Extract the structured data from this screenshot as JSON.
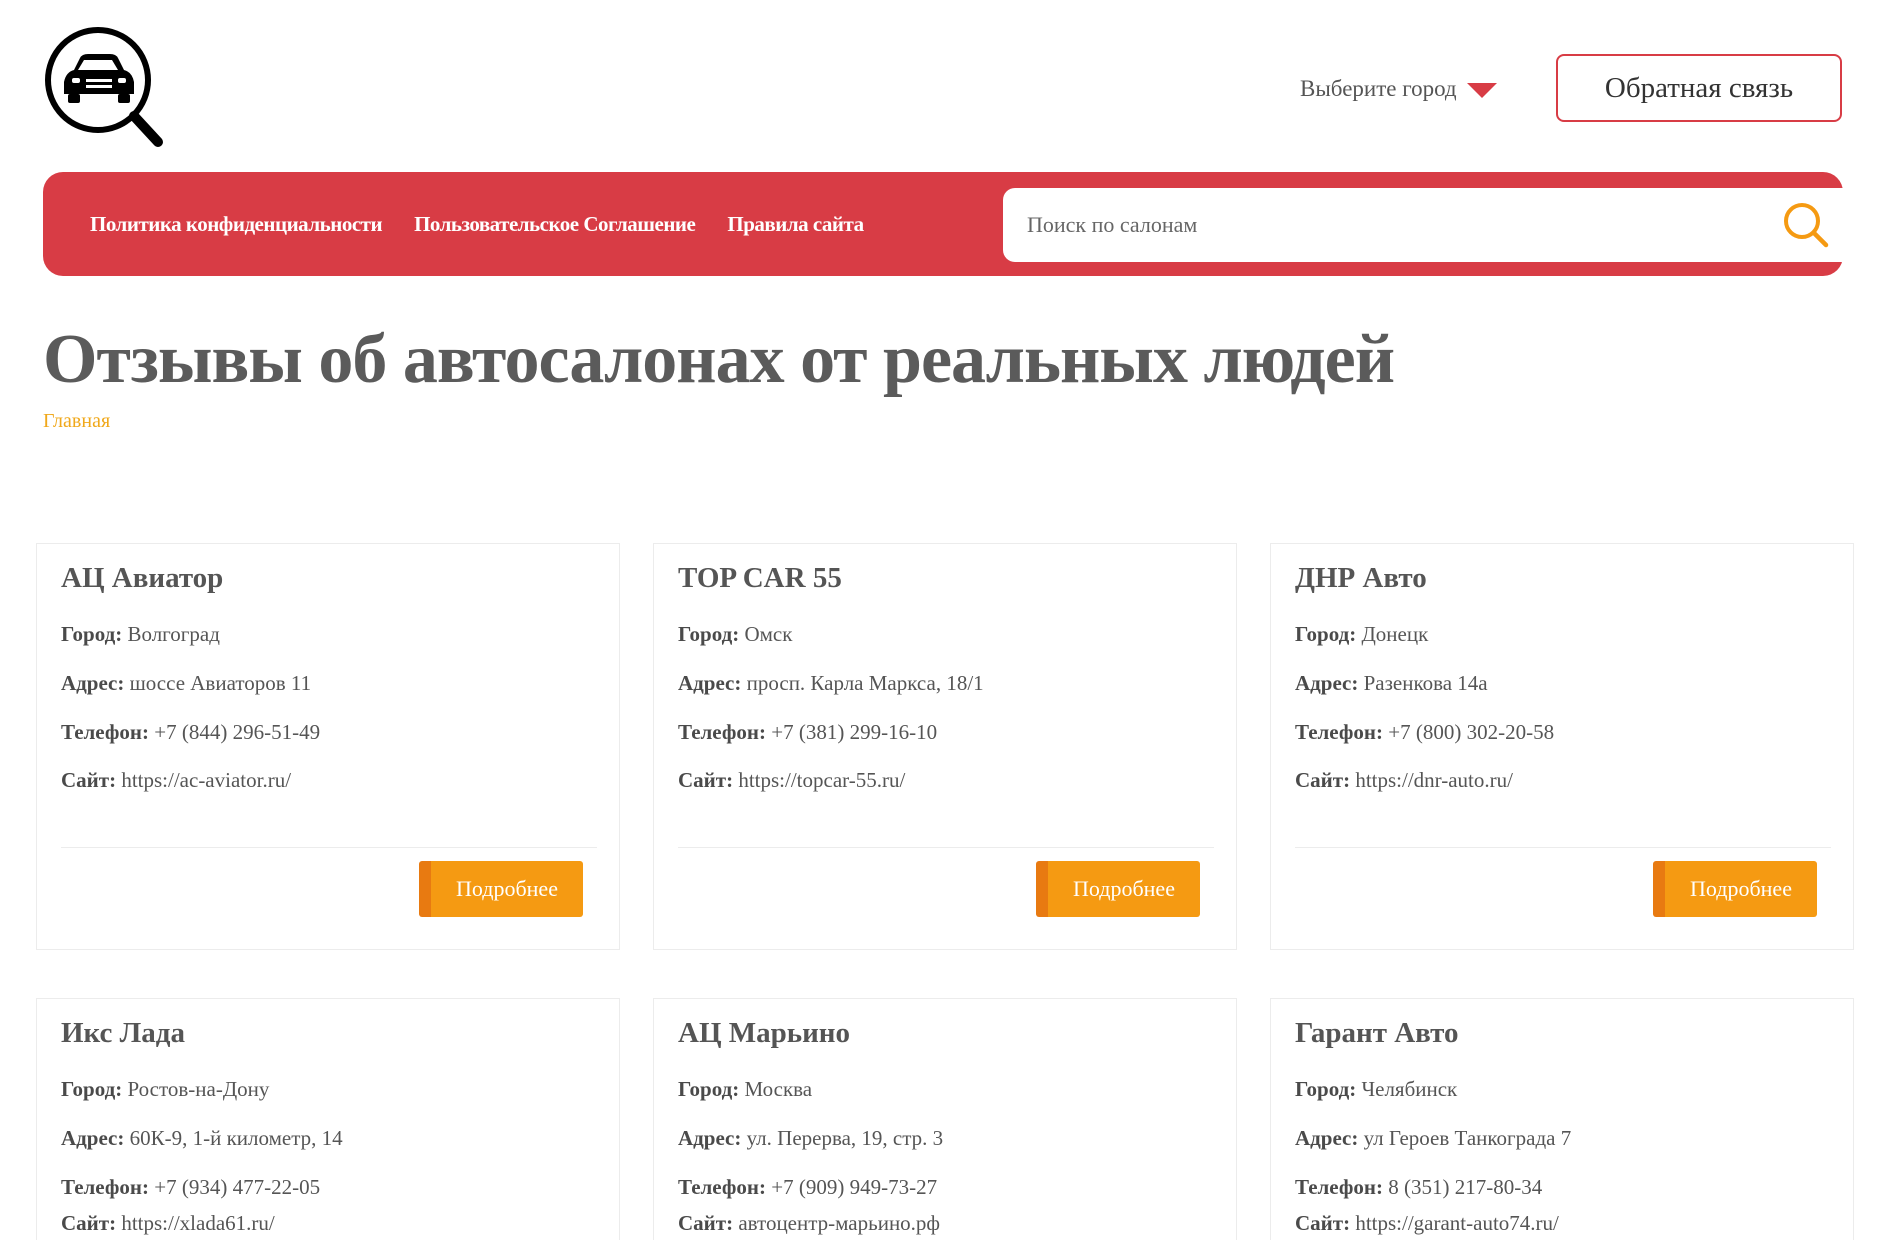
{
  "header": {
    "city_select_label": "Выберите город",
    "feedback_button": "Обратная связь"
  },
  "nav": {
    "links": [
      "Политика конфиденциальности",
      "Пользовательское Соглашение",
      "Правила сайта"
    ],
    "search_placeholder": "Поиск по салонам"
  },
  "page": {
    "title": "Отзывы об автосалонах от реальных людей",
    "breadcrumb": "Главная"
  },
  "field_labels": {
    "city": "Город:",
    "address": "Адрес:",
    "phone": "Телефон:",
    "site": "Сайт:"
  },
  "more_button": "Подробнее",
  "dealers": [
    {
      "name": "АЦ Авиатор",
      "city": "Волгоград",
      "address": "шоссе Авиаторов 11",
      "phone": "+7 (844) 296-51-49",
      "site": "https://ac-aviator.ru/"
    },
    {
      "name": "TOP CAR 55",
      "city": "Омск",
      "address": "просп. Карла Маркса, 18/1",
      "phone": "+7 (381) 299-16-10",
      "site": "https://topcar-55.ru/"
    },
    {
      "name": "ДНР Авто",
      "city": "Донецк",
      "address": "Разенкова 14а",
      "phone": "+7 (800) 302-20-58",
      "site": "https://dnr-auto.ru/"
    },
    {
      "name": "Икс Лада",
      "city": "Ростов-на-Дону",
      "address": "60К-9, 1-й километр, 14",
      "phone": "+7 (934) 477-22-05",
      "site": "https://xlada61.ru/"
    },
    {
      "name": "АЦ Марьино",
      "city": "Москва",
      "address": "ул. Перерва, 19, стр. 3",
      "phone": "+7 (909) 949-73-27",
      "site": "автоцентр-марьино.рф"
    },
    {
      "name": "Гарант Авто",
      "city": "Челябинск",
      "address": "ул Героев Танкограда 7",
      "phone": "8 (351) 217-80-34",
      "site": "https://garant-auto74.ru/"
    }
  ],
  "colors": {
    "accent_red": "#d83c45",
    "button_orange": "#f59a12",
    "breadcrumb_orange": "#f0a81b"
  }
}
